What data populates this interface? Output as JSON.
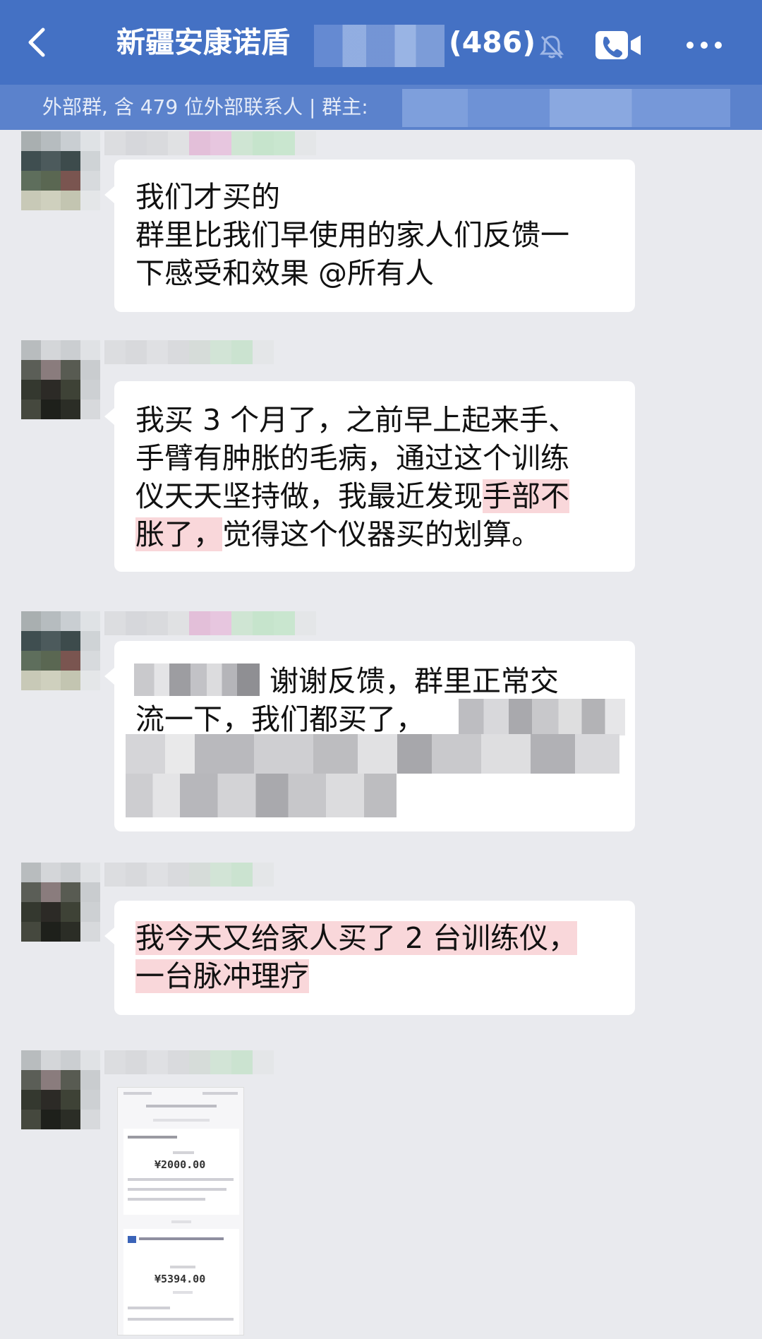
{
  "header": {
    "title": "新疆安康诺盾",
    "member_count": "(486)"
  },
  "subheader": {
    "text": "外部群, 含 479 位外部联系人 | 群主:"
  },
  "messages": [
    {
      "lines": [
        "我们才买的",
        "群里比我们早使用的家人们反馈一",
        "下感受和效果 @所有人"
      ]
    },
    {
      "line1": "我买 3 个月了，之前早上起来手、",
      "line2": "手臂有肿胀的毛病，通过这个训练",
      "line3_plain": "仪天天坚持做，我最近发现",
      "line3_hl": "手部不",
      "line4_hl": "胀了，",
      "line4_plain": "觉得这个仪器买的划算。"
    },
    {
      "line1": "谢谢反馈，群里正常交",
      "line2": "流一下，我们都买了，"
    },
    {
      "line1": "我今天又给家人买了 2 台训练仪，",
      "line2": "一台脉冲理疗"
    }
  ],
  "image_message": {
    "amount_1": "¥2000.00",
    "amount_2": "¥5394.00"
  },
  "colors": {
    "header_bg": "#4471c4",
    "subheader_bg": "#5b82cc",
    "chat_bg": "#e9eaee",
    "highlight": "#f9d7da"
  }
}
